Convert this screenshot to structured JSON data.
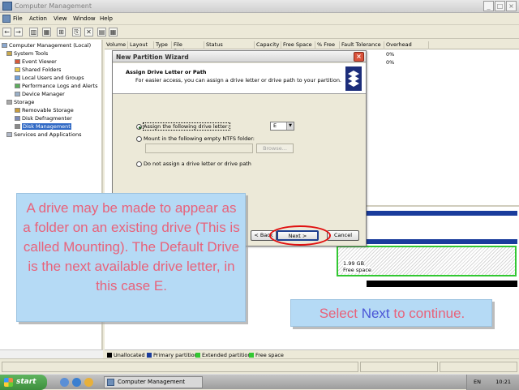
{
  "window": {
    "title": "Computer Management",
    "controls": [
      "_",
      "□",
      "×"
    ]
  },
  "menu": {
    "items": [
      "File",
      "Action",
      "View",
      "Window",
      "Help"
    ]
  },
  "toolbar": {
    "buttons": [
      "←",
      "→",
      "▥",
      "▦",
      "⊞",
      "✕",
      "⎘",
      "▤",
      "▦"
    ]
  },
  "tree": {
    "items": [
      "Computer Management (Local)",
      "System Tools",
      "Event Viewer",
      "Shared Folders",
      "Local Users and Groups",
      "Performance Logs and Alerts",
      "Device Manager",
      "Storage",
      "Removable Storage",
      "Disk Defragmenter",
      "Disk Management",
      "Services and Applications"
    ]
  },
  "volume_list": {
    "columns": [
      "Volume",
      "Layout",
      "Type",
      "File System",
      "Status",
      "Capacity",
      "Free Space",
      "% Free",
      "Fault Tolerance",
      "Overhead"
    ],
    "rows": [
      {
        "overhead": "0%"
      },
      {
        "overhead": "0%"
      }
    ]
  },
  "disk_pane": {
    "free_size": "1.99 GB",
    "free_label": "Free space"
  },
  "legend": {
    "items": [
      {
        "label": "Unallocated",
        "color": "#000000"
      },
      {
        "label": "Primary partition",
        "color": "#1a3c9c"
      },
      {
        "label": "Extended partition",
        "color": "#32c832"
      },
      {
        "label": "Free space",
        "color": "#32c832"
      }
    ]
  },
  "wizard": {
    "title": "New Partition Wizard",
    "close": "×",
    "heading": "Assign Drive Letter or Path",
    "subheading": "For easier access, you can assign a drive letter or drive path to your partition.",
    "options": [
      {
        "label": "Assign the following drive letter:",
        "selected": true
      },
      {
        "label": "Mount in the following empty NTFS folder:",
        "selected": false
      },
      {
        "label": "Do not assign a drive letter or drive path",
        "selected": false
      }
    ],
    "drive_letter": "E",
    "browse_label": "Browse...",
    "buttons": {
      "back": "< Back",
      "next": "Next >",
      "cancel": "Cancel"
    }
  },
  "callouts": {
    "left": "A drive may be made to appear as a folder on an existing drive (This is called Mounting). The Default Drive is the next available drive letter, in this case E.",
    "right_prefix": "Select ",
    "right_highlight": "Next",
    "right_suffix": " to continue."
  },
  "taskbar": {
    "start_label": "start",
    "task_label": "Computer Management",
    "language": "EN",
    "clock": "10:21"
  },
  "colors": {
    "callout_bg": "#b5daf5",
    "callout_text": "#e8627a",
    "callout_highlight": "#4a55d6",
    "highlight_ellipse": "#e01010",
    "selection": "#316ac5"
  }
}
